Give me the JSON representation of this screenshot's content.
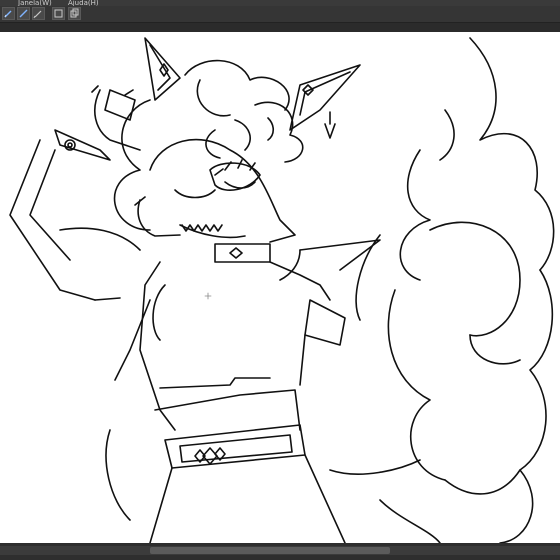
{
  "menubar": {
    "items": [
      "Janela(W)",
      "Ajuda(H)"
    ]
  },
  "toolbar": {
    "tools": [
      {
        "name": "pen-tool-icon"
      },
      {
        "name": "pencil-tool-icon"
      },
      {
        "name": "brush-tool-icon"
      },
      {
        "name": "layer-icon"
      },
      {
        "name": "copy-layer-icon"
      }
    ]
  },
  "canvas": {
    "background": "#ffffff",
    "line_color": "#111111",
    "content": "line-art character drawing"
  },
  "colors": {
    "ui_dark": "#2b2b2b",
    "toolbar": "#353535",
    "menubar": "#3a3a3a"
  }
}
